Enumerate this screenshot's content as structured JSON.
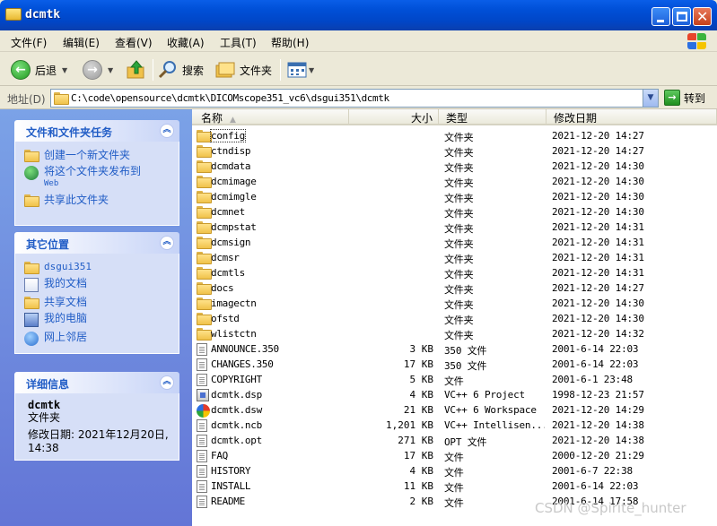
{
  "window": {
    "title": "dcmtk"
  },
  "menu": [
    "文件(F)",
    "编辑(E)",
    "查看(V)",
    "收藏(A)",
    "工具(T)",
    "帮助(H)"
  ],
  "toolbar": {
    "back_label": "后退",
    "search_label": "搜索",
    "folders_label": "文件夹"
  },
  "address": {
    "label": "地址(D)",
    "path": "C:\\code\\opensource\\dcmtk\\DICOMscope351_vc6\\dsgui351\\dcmtk",
    "go_label": "转到"
  },
  "tasks_panel": {
    "title": "文件和文件夹任务",
    "items": [
      {
        "label": "创建一个新文件夹",
        "icon": "new-folder-icon"
      },
      {
        "label": "将这个文件夹发布到",
        "sub": "Web",
        "icon": "publish-web-icon"
      },
      {
        "label": "共享此文件夹",
        "icon": "share-folder-icon"
      }
    ]
  },
  "places_panel": {
    "title": "其它位置",
    "items": [
      {
        "label": "dsgui351",
        "icon": "folder-icon"
      },
      {
        "label": "我的文档",
        "icon": "my-documents-icon"
      },
      {
        "label": "共享文档",
        "icon": "shared-documents-icon"
      },
      {
        "label": "我的电脑",
        "icon": "my-computer-icon"
      },
      {
        "label": "网上邻居",
        "icon": "network-places-icon"
      }
    ]
  },
  "details_panel": {
    "title": "详细信息",
    "name": "dcmtk",
    "kind": "文件夹",
    "modified_line1": "修改日期: 2021年12月20日,",
    "modified_line2": "14:38"
  },
  "columns": {
    "name": "名称",
    "size": "大小",
    "type": "类型",
    "date": "修改日期"
  },
  "files": [
    {
      "name": "config",
      "size": "",
      "type": "文件夹",
      "date": "2021-12-20 14:27",
      "icon": "folder"
    },
    {
      "name": "ctndisp",
      "size": "",
      "type": "文件夹",
      "date": "2021-12-20 14:27",
      "icon": "folder"
    },
    {
      "name": "dcmdata",
      "size": "",
      "type": "文件夹",
      "date": "2021-12-20 14:30",
      "icon": "folder"
    },
    {
      "name": "dcmimage",
      "size": "",
      "type": "文件夹",
      "date": "2021-12-20 14:30",
      "icon": "folder"
    },
    {
      "name": "dcmimgle",
      "size": "",
      "type": "文件夹",
      "date": "2021-12-20 14:30",
      "icon": "folder"
    },
    {
      "name": "dcmnet",
      "size": "",
      "type": "文件夹",
      "date": "2021-12-20 14:30",
      "icon": "folder"
    },
    {
      "name": "dcmpstat",
      "size": "",
      "type": "文件夹",
      "date": "2021-12-20 14:31",
      "icon": "folder"
    },
    {
      "name": "dcmsign",
      "size": "",
      "type": "文件夹",
      "date": "2021-12-20 14:31",
      "icon": "folder"
    },
    {
      "name": "dcmsr",
      "size": "",
      "type": "文件夹",
      "date": "2021-12-20 14:31",
      "icon": "folder"
    },
    {
      "name": "dcmtls",
      "size": "",
      "type": "文件夹",
      "date": "2021-12-20 14:31",
      "icon": "folder"
    },
    {
      "name": "docs",
      "size": "",
      "type": "文件夹",
      "date": "2021-12-20 14:27",
      "icon": "folder"
    },
    {
      "name": "imagectn",
      "size": "",
      "type": "文件夹",
      "date": "2021-12-20 14:30",
      "icon": "folder"
    },
    {
      "name": "ofstd",
      "size": "",
      "type": "文件夹",
      "date": "2021-12-20 14:30",
      "icon": "folder"
    },
    {
      "name": "wlistctn",
      "size": "",
      "type": "文件夹",
      "date": "2021-12-20 14:32",
      "icon": "folder"
    },
    {
      "name": "ANNOUNCE.350",
      "size": "3 KB",
      "type": "350 文件",
      "date": "2001-6-14 22:03",
      "icon": "file"
    },
    {
      "name": "CHANGES.350",
      "size": "17 KB",
      "type": "350 文件",
      "date": "2001-6-14 22:03",
      "icon": "file"
    },
    {
      "name": "COPYRIGHT",
      "size": "5 KB",
      "type": "文件",
      "date": "2001-6-1 23:48",
      "icon": "file"
    },
    {
      "name": "dcmtk.dsp",
      "size": "4 KB",
      "type": "VC++ 6 Project",
      "date": "1998-12-23 21:57",
      "icon": "project"
    },
    {
      "name": "dcmtk.dsw",
      "size": "21 KB",
      "type": "VC++ 6 Workspace",
      "date": "2021-12-20 14:29",
      "icon": "workspace"
    },
    {
      "name": "dcmtk.ncb",
      "size": "1,201 KB",
      "type": "VC++ Intellisen...",
      "date": "2021-12-20 14:38",
      "icon": "file"
    },
    {
      "name": "dcmtk.opt",
      "size": "271 KB",
      "type": "OPT 文件",
      "date": "2021-12-20 14:38",
      "icon": "file"
    },
    {
      "name": "FAQ",
      "size": "17 KB",
      "type": "文件",
      "date": "2000-12-20 21:29",
      "icon": "file"
    },
    {
      "name": "HISTORY",
      "size": "4 KB",
      "type": "文件",
      "date": "2001-6-7 22:38",
      "icon": "file"
    },
    {
      "name": "INSTALL",
      "size": "11 KB",
      "type": "文件",
      "date": "2001-6-14 22:03",
      "icon": "file"
    },
    {
      "name": "README",
      "size": "2 KB",
      "type": "文件",
      "date": "2001-6-14 17:58",
      "icon": "file"
    }
  ],
  "watermark": "CSDN @Spirite_hunter"
}
